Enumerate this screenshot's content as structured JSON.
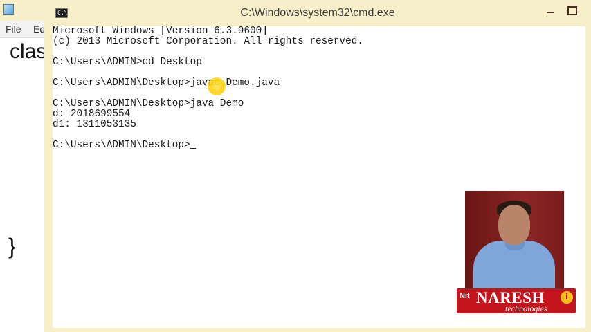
{
  "background_editor": {
    "menu": [
      "File",
      "Ed"
    ],
    "code_fragment": "clas",
    "closing_brace": "}"
  },
  "cmd_window": {
    "title": "C:\\Windows\\system32\\cmd.exe",
    "icon_label": "C:\\",
    "lines": [
      "Microsoft Windows [Version 6.3.9600]",
      "(c) 2013 Microsoft Corporation. All rights reserved.",
      "",
      "C:\\Users\\ADMIN>cd Desktop",
      "",
      "C:\\Users\\ADMIN\\Desktop>javac Demo.java",
      "",
      "C:\\Users\\ADMIN\\Desktop>java Demo",
      "d: 2018699554",
      "d1: 1311053135",
      "",
      "C:\\Users\\ADMIN\\Desktop>"
    ]
  },
  "logo": {
    "mark": "Nit",
    "name": "NARESH",
    "i_letter": "i",
    "tagline": "technologies"
  },
  "colors": {
    "titlebar": "#f6efc9",
    "console_bg": "#ffffff",
    "console_text": "#1a1a1a",
    "logo_red": "#c4151c"
  }
}
